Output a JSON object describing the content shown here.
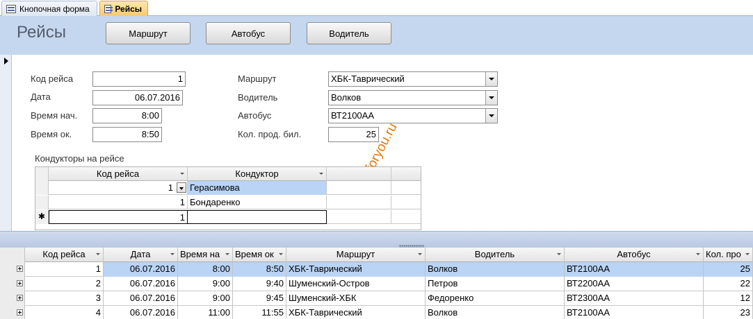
{
  "tabs": [
    {
      "label": "Кнопочная форма",
      "active": false
    },
    {
      "label": "Рейсы",
      "active": true
    }
  ],
  "header": {
    "title": "Рейсы",
    "buttons": [
      "Маршрут",
      "Автобус",
      "Водитель"
    ]
  },
  "detail": {
    "labels": {
      "trip_code": "Код рейса",
      "date": "Дата",
      "start_time": "Время нач.",
      "end_time": "Время ок.",
      "route": "Маршрут",
      "driver": "Водитель",
      "bus": "Автобус",
      "tickets": "Кол. прод. бил."
    },
    "values": {
      "trip_code": "1",
      "date": "06.07.2016",
      "start_time": "8:00",
      "end_time": "8:50",
      "route": "ХБК-Таврический",
      "driver": "Волков",
      "bus": "ВТ2100АА",
      "tickets": "25"
    }
  },
  "watermark": "dbforyou.ru",
  "subform": {
    "caption": "Кондукторы на рейсе",
    "headers": [
      "Код рейса",
      "Кондуктор"
    ],
    "rows": [
      {
        "code": "1",
        "conductor": "Герасимова"
      },
      {
        "code": "1",
        "conductor": "Бондаренко"
      }
    ],
    "new_row_code": "1",
    "new_row_marker": "✱"
  },
  "datasheet": {
    "headers": [
      "Код рейса",
      "Дата",
      "Время на",
      "Время ок",
      "Маршрут",
      "Водитель",
      "Автобус",
      "Кол. про"
    ],
    "rows": [
      {
        "code": "1",
        "date": "06.07.2016",
        "start": "8:00",
        "end": "8:50",
        "route": "ХБК-Таврический",
        "driver": "Волков",
        "bus": "ВТ2100АА",
        "tickets": "25"
      },
      {
        "code": "2",
        "date": "06.07.2016",
        "start": "9:00",
        "end": "9:40",
        "route": "Шуменский-Остров",
        "driver": "Петров",
        "bus": "ВТ2200АА",
        "tickets": "22"
      },
      {
        "code": "3",
        "date": "06.07.2016",
        "start": "9:00",
        "end": "9:45",
        "route": "Шуменский-ХБК",
        "driver": "Федоренко",
        "bus": "ВТ2300АА",
        "tickets": "12"
      },
      {
        "code": "4",
        "date": "06.07.2016",
        "start": "11:00",
        "end": "11:55",
        "route": "ХБК-Таврический",
        "driver": "Волков",
        "bus": "ВТ2100АА",
        "tickets": "23"
      }
    ]
  },
  "colors": {
    "header_band": "#c5d7ee",
    "active_tab": "#f7c868",
    "selected_row": "#b9d4f5",
    "watermark": "#e07a10"
  }
}
